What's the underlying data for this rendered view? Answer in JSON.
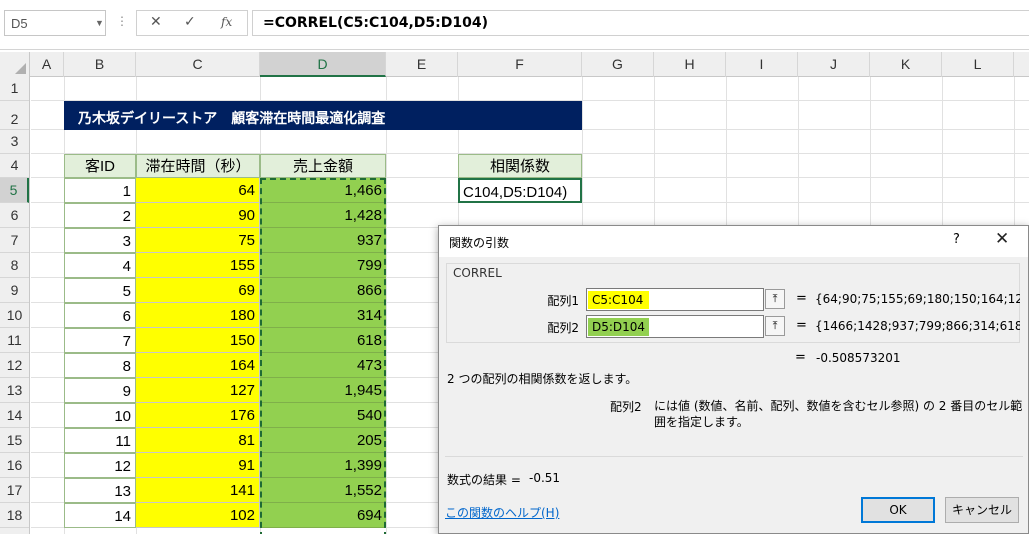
{
  "formula_bar": {
    "name_box": "D5",
    "formula": "=CORREL(C5:C104,D5:D104)",
    "icons": [
      "cancel-icon",
      "enter-icon",
      "insert-function-icon"
    ],
    "fx_label": "fx"
  },
  "columns": [
    "A",
    "B",
    "C",
    "D",
    "E",
    "F",
    "G",
    "H",
    "I",
    "J",
    "K",
    "L"
  ],
  "rows": [
    "1",
    "2",
    "3",
    "4",
    "5",
    "6",
    "7",
    "8",
    "9",
    "10",
    "11",
    "12",
    "13",
    "14",
    "15",
    "16",
    "17",
    "18"
  ],
  "sheet": {
    "title": "乃木坂デイリーストア　顧客滞在時間最適化調査",
    "headers": {
      "id": "客ID",
      "time": "滞在時間（秒）",
      "sales": "売上金額"
    },
    "table": [
      [
        "1",
        "64",
        "1,466"
      ],
      [
        "2",
        "90",
        "1,428"
      ],
      [
        "3",
        "75",
        "937"
      ],
      [
        "4",
        "155",
        "799"
      ],
      [
        "5",
        "69",
        "866"
      ],
      [
        "6",
        "180",
        "314"
      ],
      [
        "7",
        "150",
        "618"
      ],
      [
        "8",
        "164",
        "473"
      ],
      [
        "9",
        "127",
        "1,945"
      ],
      [
        "10",
        "176",
        "540"
      ],
      [
        "11",
        "81",
        "205"
      ],
      [
        "12",
        "91",
        "1,399"
      ],
      [
        "13",
        "141",
        "1,552"
      ],
      [
        "14",
        "102",
        "694"
      ]
    ],
    "correl_header": "相関係数",
    "correl_cell": "C104,D5:D104)"
  },
  "colors": {
    "title_bg": "#002060",
    "header_bg": "#e2efda",
    "time_fill": "#ffff00",
    "sales_fill": "#92d050",
    "selection": "#217346",
    "ok_border": "#0078d7"
  },
  "dialog": {
    "title": "関数の引数",
    "help_glyph": "?",
    "close_glyph": "✕",
    "function_name": "CORREL",
    "args": [
      {
        "label": "配列1",
        "value": "C5:C104",
        "result": "{64;90;75;155;69;180;150;164;12"
      },
      {
        "label": "配列2",
        "value": "D5:D104",
        "result": "{1466;1428;937;799;866;314;618"
      }
    ],
    "eq": "=",
    "result": "-0.508573201",
    "description": "2 つの配列の相関係数を返します。",
    "arg_desc_name": "配列2",
    "arg_desc_text": "には値 (数値、名前、配列、数値を含むセル参照) の 2 番目のセル範囲を指定します。",
    "formula_result_label": "数式の結果 =",
    "formula_result_value": "-0.51",
    "help_link": "この関数のヘルプ(H)",
    "ok": "OK",
    "cancel": "キャンセル"
  }
}
